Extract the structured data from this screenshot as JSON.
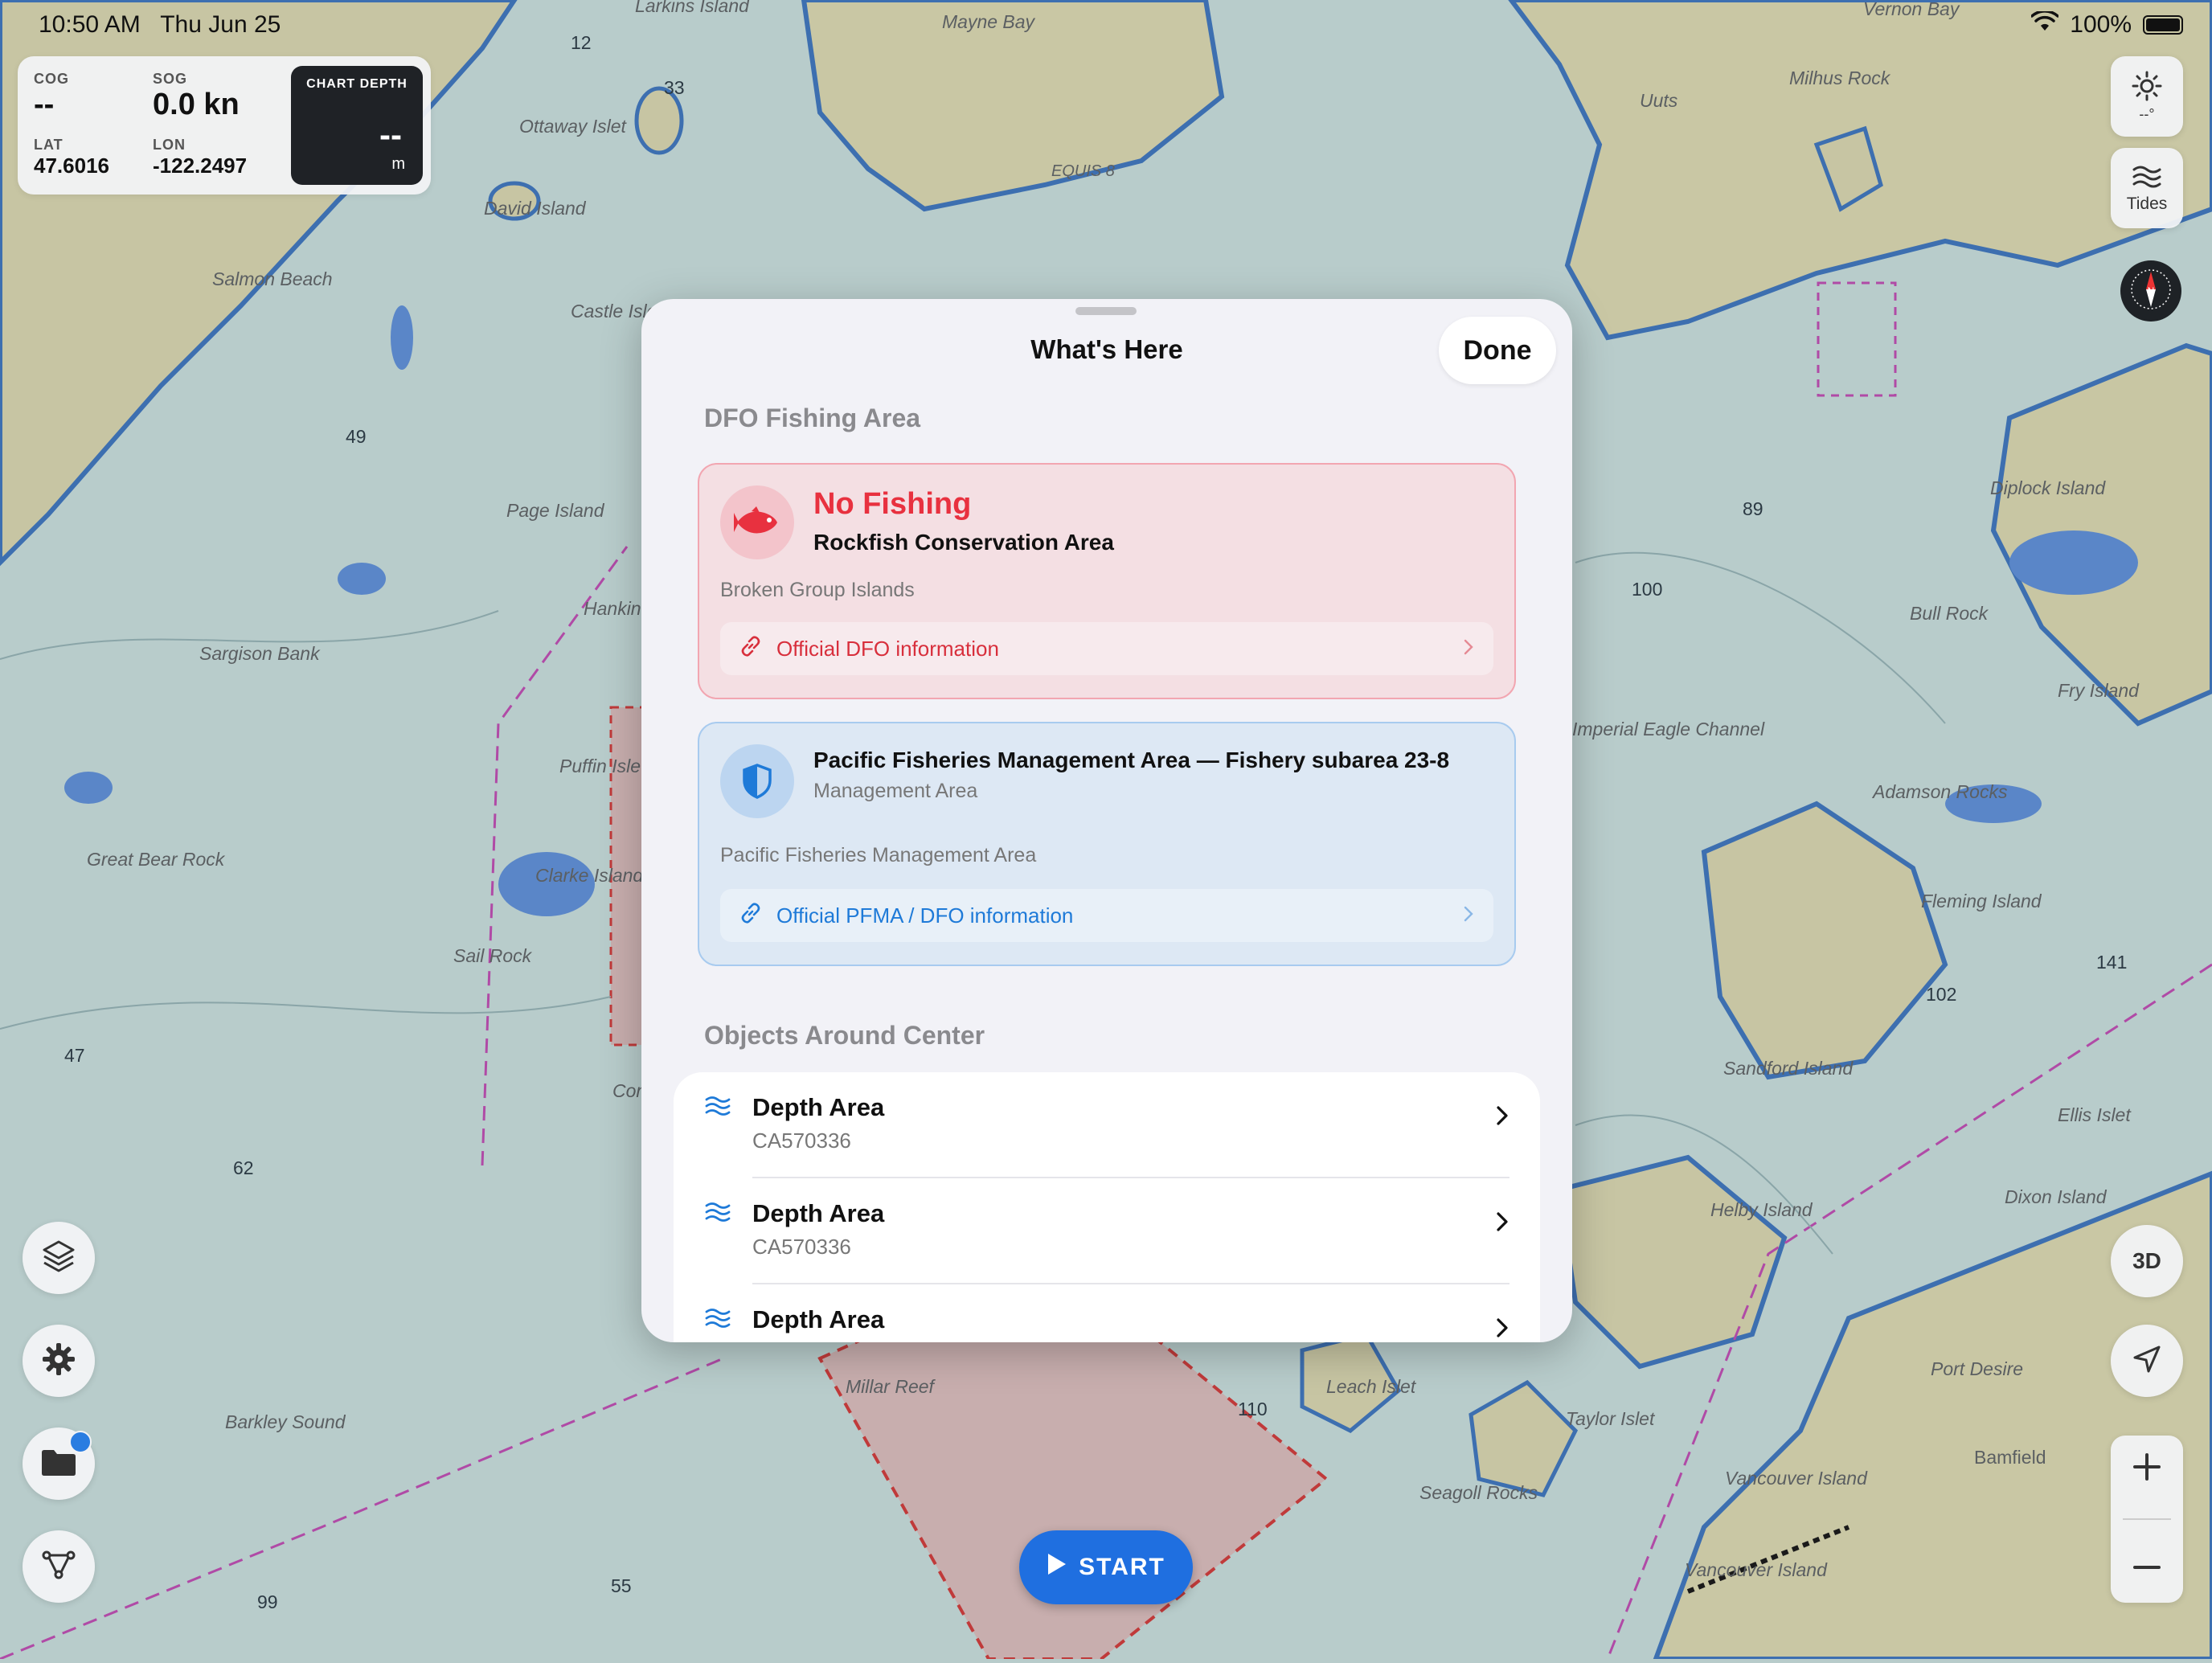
{
  "status_bar": {
    "time": "10:50 AM",
    "date": "Thu Jun 25",
    "battery": "100%"
  },
  "nav_panel": {
    "cog_label": "COG",
    "cog_value": "--",
    "sog_label": "SOG",
    "sog_value": "0.0 kn",
    "lat_label": "LAT",
    "lat_value": "47.6016",
    "lon_label": "LON",
    "lon_value": "-122.2497",
    "depth_label": "CHART DEPTH",
    "depth_value": "--",
    "depth_unit": "m"
  },
  "map": {
    "place_labels": [
      "Larkins Island",
      "Mayne Bay",
      "Vernon Bay",
      "Milhus Rock",
      "Uuts",
      "Ottaway Islet",
      "David Island",
      "EQUIS 8",
      "Salmon Beach",
      "Castle Isle",
      "Page Island",
      "Hankin",
      "Sargison Bank",
      "Puffin Isle",
      "Clarke Island",
      "Great Bear Rock",
      "Sail Rock",
      "Combe",
      "Millar Reef",
      "Barkley Sound",
      "Diplock Island",
      "Bull Rock",
      "Fry Island",
      "Imperial Eagle Channel",
      "Adamson Rocks",
      "Fleming Island",
      "Sandford Island",
      "Ellis Islet",
      "Dixon Island",
      "Helby Island",
      "Leach Islet",
      "Taylor Islet",
      "Seagoll Rocks",
      "Port Desire",
      "Bamfield",
      "Vancouver Island",
      "Tides",
      "3D"
    ],
    "colors": {
      "water": "#b8cccb",
      "land": "#c9c7a4",
      "shallow": "#4a7fc4",
      "restricted_zone": "#d8a3a5"
    }
  },
  "controls": {
    "light_value": "--°",
    "tides_label": "Tides",
    "three_d_label": "3D",
    "start_label": "START"
  },
  "sheet": {
    "title": "What's Here",
    "done_label": "Done",
    "section_fishing": "DFO Fishing Area",
    "no_fishing": {
      "title": "No Fishing",
      "subtitle": "Rockfish Conservation Area",
      "location": "Broken Group Islands",
      "link": "Official DFO information"
    },
    "pfma": {
      "title": "Pacific Fisheries Management Area — Fishery subarea 23-8",
      "subtitle": "Management Area",
      "location": "Pacific Fisheries Management Area",
      "link": "Official PFMA / DFO information"
    },
    "section_objects": "Objects Around Center",
    "objects": [
      {
        "title": "Depth Area",
        "sub": "CA570336"
      },
      {
        "title": "Depth Area",
        "sub": "CA570336"
      },
      {
        "title": "Depth Area",
        "sub": ""
      }
    ]
  }
}
